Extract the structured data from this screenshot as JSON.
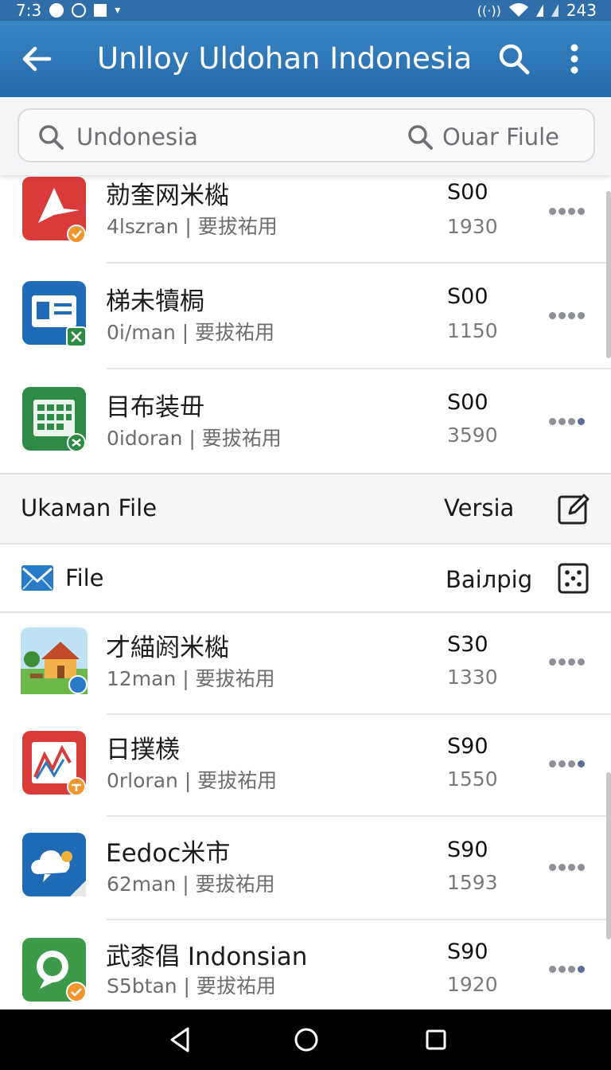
{
  "status_bar": {
    "time": "7:3",
    "right_text": "243"
  },
  "app_bar": {
    "title": "Unlloy Uldohan Indonesia"
  },
  "search": {
    "left_text": "Undonesia",
    "right_text": "Ouar Fiule"
  },
  "apps_top": [
    {
      "name": "勍奎网米檆",
      "meta": "4lszran | 要拔祐用",
      "price": "S00",
      "count": "1930",
      "icon": "star-app-icon"
    },
    {
      "name": "梯未犢梮",
      "meta": "0i/man | 要拔祐用",
      "price": "S00",
      "count": "1150",
      "icon": "card-app-icon"
    },
    {
      "name": "目布装毌",
      "meta": "0idoran | 要拔祐用",
      "price": "S00",
      "count": "3590",
      "icon": "calendar-app-icon"
    }
  ],
  "section_1": {
    "left": "Ukaмan File",
    "right": "Versia",
    "icon": "edit-icon"
  },
  "section_2": {
    "left": "File",
    "right": "Baiлpig",
    "left_icon": "mail-icon",
    "icon": "dice-icon"
  },
  "apps_bottom": [
    {
      "name": "才緢阏米檆",
      "meta": "12man | 要拔祐用",
      "price": "S30",
      "count": "1330",
      "icon": "house-app-icon"
    },
    {
      "name": "日撲檨",
      "meta": "0rloran | 要拔祐用",
      "price": "S90",
      "count": "1550",
      "icon": "chart-app-icon"
    },
    {
      "name": "Eedoc米市",
      "meta": "62man | 要拔祐用",
      "price": "S90",
      "count": "1593",
      "icon": "weather-app-icon"
    },
    {
      "name": "武桼倡 Indonsian",
      "meta": "S5btan | 要拔祐用",
      "price": "S90",
      "count": "1920",
      "icon": "chat-app-icon"
    }
  ],
  "colors": {
    "app_bar": "#2f78b8",
    "accent_badge": "#f0962a",
    "green_badge": "#2e8b46"
  }
}
